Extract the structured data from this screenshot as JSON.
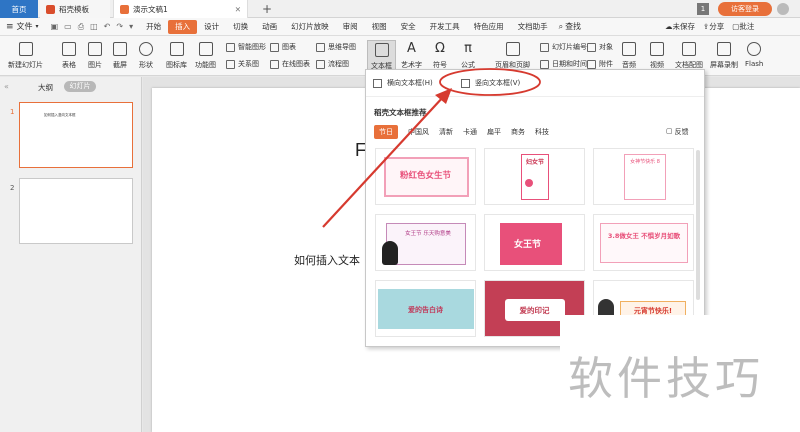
{
  "titlebar": {
    "tab_home": "首页",
    "tab_template": "稻壳模板",
    "tab_doc": "演示文稿1",
    "page_badge": "1",
    "login_label": "访客登录"
  },
  "menubar": {
    "file": "文件",
    "items": [
      "开始",
      "插入",
      "设计",
      "切换",
      "动画",
      "幻灯片放映",
      "审阅",
      "视图",
      "安全",
      "开发工具",
      "特色应用",
      "文档助手"
    ],
    "search": "查找",
    "unsaved": "未保存",
    "share": "分享",
    "annotate": "批注"
  },
  "toolbar": {
    "new_slide": "新建幻灯片",
    "table": "表格",
    "picture": "图片",
    "screenshot": "截屏",
    "shape": "形状",
    "icon_lib": "图标库",
    "func_chart": "功能图",
    "smart_graphic": "智能图形",
    "chart": "图表",
    "mindmap": "思维导图",
    "relation": "关系图",
    "online_chart": "在线图表",
    "flowchart": "流程图",
    "textbox": "文本框",
    "wordart": "艺术字",
    "symbol": "符号",
    "formula": "公式",
    "header_footer": "页眉和页脚",
    "slide_number": "幻灯片编号",
    "object": "对象",
    "datetime": "日期和时间",
    "attachment": "附件",
    "audio": "音频",
    "video": "视频",
    "doc_note": "文档配图",
    "screen_record": "屏幕录制",
    "flash": "Flash"
  },
  "leftpanel": {
    "tab_outline": "大纲",
    "tab_slides": "幻灯片",
    "slide1_num": "1",
    "slide2_num": "2",
    "slide1_text": "如何插入竖向文本框"
  },
  "slide": {
    "body_text": "如何插入文本",
    "title_fragment": "F"
  },
  "dropdown": {
    "horizontal": "横向文本框(H)",
    "vertical": "竖向文本框(V)",
    "section_title": "稻壳文本框推荐",
    "categories": [
      "节日",
      "中国风",
      "清新",
      "卡通",
      "扁平",
      "商务",
      "科技"
    ],
    "feedback": "反馈",
    "cards": [
      {
        "title": "粉红色女生节"
      },
      {
        "title": "妇女节"
      },
      {
        "title": "女神节快乐 8"
      },
      {
        "title": "女王节 乐天购意美"
      },
      {
        "title": "女王节"
      },
      {
        "title": "3.8做女王 不惧岁月如歌"
      },
      {
        "title": "爱的告白诗"
      },
      {
        "title": "爱的印记"
      },
      {
        "title": "元宵节快乐!"
      }
    ]
  },
  "watermark": "软件技巧",
  "colors": {
    "accent_orange": "#e8703a",
    "home_blue": "#2e75c5",
    "annotation_red": "#d63a2f",
    "pink": "#e8507a"
  }
}
